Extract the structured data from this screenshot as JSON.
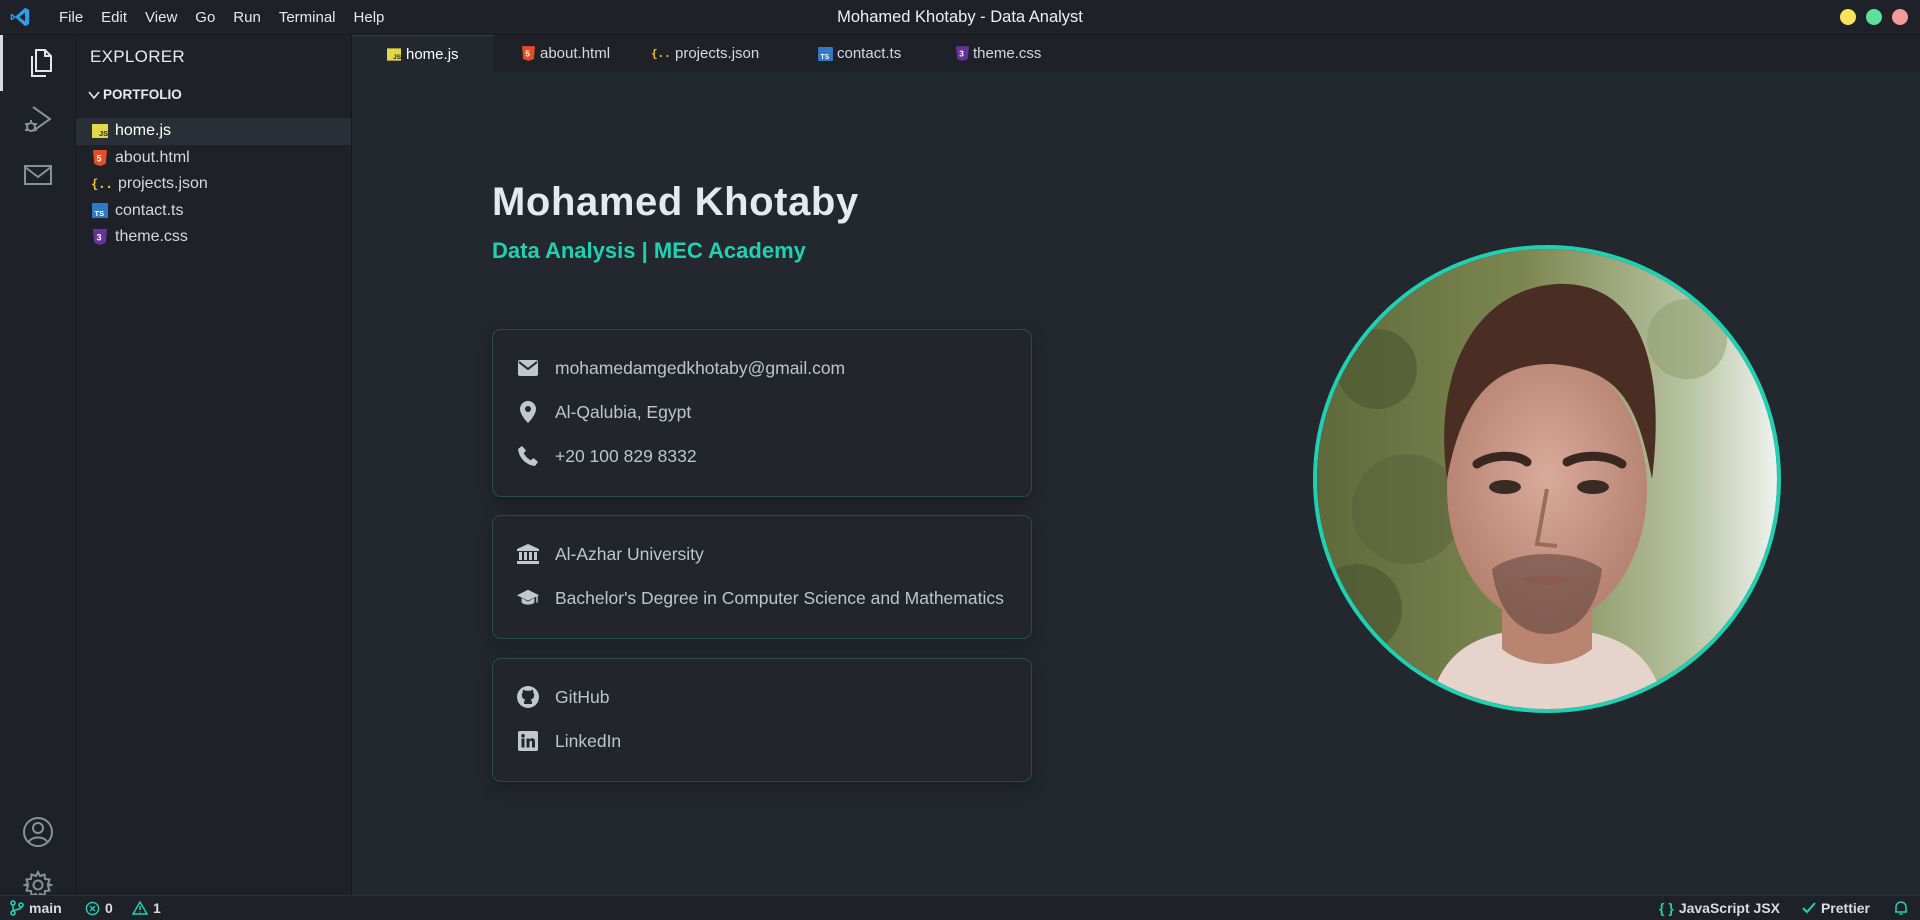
{
  "window": {
    "title": "Mohamed Khotaby - Data Analyst"
  },
  "menu": [
    "File",
    "Edit",
    "View",
    "Go",
    "Run",
    "Terminal",
    "Help"
  ],
  "sidebar": {
    "title": "EXPLORER",
    "section": "PORTFOLIO",
    "files": [
      {
        "name": "home.js",
        "icon": "js-file-icon",
        "selected": true
      },
      {
        "name": "about.html",
        "icon": "html-file-icon"
      },
      {
        "name": "projects.json",
        "icon": "json-file-icon"
      },
      {
        "name": "contact.ts",
        "icon": "ts-file-icon"
      },
      {
        "name": "theme.css",
        "icon": "css-file-icon"
      }
    ]
  },
  "tabs": [
    {
      "label": "home.js",
      "active": true
    },
    {
      "label": "about.html"
    },
    {
      "label": "projects.json"
    },
    {
      "label": "contact.ts"
    },
    {
      "label": "theme.css"
    }
  ],
  "profile": {
    "name": "Mohamed Khotaby",
    "subtitle": "Data Analysis | MEC Academy",
    "contact": {
      "email": "mohamedamgedkhotaby@gmail.com",
      "location": "Al-Qalubia, Egypt",
      "phone": "+20 100 829 8332"
    },
    "education": {
      "university": "Al-Azhar University",
      "degree": "Bachelor's Degree in Computer Science and Mathematics"
    },
    "links": {
      "github": "GitHub",
      "linkedin": "LinkedIn"
    }
  },
  "statusbar": {
    "branch": "main",
    "errors": "0",
    "warnings": "1",
    "language": "JavaScript JSX",
    "formatter": "Prettier"
  },
  "colors": {
    "accent": "#1fd1b2",
    "background": "#23272e",
    "chrome": "#1e2228"
  }
}
